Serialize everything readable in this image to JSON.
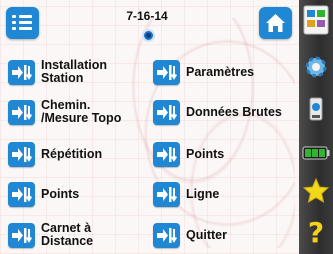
{
  "header": {
    "date": "7-16-14"
  },
  "menu": {
    "left": [
      {
        "label": "Installation\nStation"
      },
      {
        "label": "Chemin.\n/Mesure Topo"
      },
      {
        "label": "Répétition"
      },
      {
        "label": "Points"
      },
      {
        "label": "Carnet à\nDistance"
      }
    ],
    "right": [
      {
        "label": "Paramètres"
      },
      {
        "label": "Données Brutes"
      },
      {
        "label": "Points"
      },
      {
        "label": "Ligne"
      },
      {
        "label": "Quitter"
      }
    ]
  },
  "sidebar": {
    "help_symbol": "?"
  },
  "colors": {
    "accent": "#1f87d3",
    "battery": "#2fb52f",
    "star": "#f2d81b",
    "help": "#f3d01b"
  }
}
